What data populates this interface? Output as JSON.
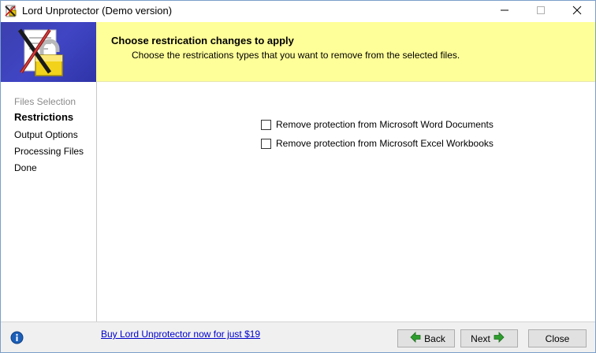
{
  "window": {
    "title": "Lord Unprotector (Demo version)",
    "icons": {
      "app": "lord-unprotector-app-icon",
      "minimize": "minimize-icon",
      "maximize": "maximize-icon",
      "close": "close-icon"
    }
  },
  "header": {
    "title": "Choose restrication changes to apply",
    "subtitle": "Choose the restrications types that you want to remove from the selected files.",
    "background_color": "#ffff99",
    "logo": "unlocked-padlock-document-logo"
  },
  "sidebar": {
    "steps": [
      {
        "label": "Files Selection",
        "state": "completed"
      },
      {
        "label": "Restrictions",
        "state": "active"
      },
      {
        "label": "Output Options",
        "state": "pending"
      },
      {
        "label": "Processing Files",
        "state": "pending"
      },
      {
        "label": "Done",
        "state": "pending"
      }
    ]
  },
  "options": [
    {
      "label": "Remove protection from Microsoft Word Documents",
      "checked": false
    },
    {
      "label": "Remove protection from Microsoft Excel Workbooks",
      "checked": false
    }
  ],
  "footer": {
    "info_icon": "info-icon",
    "buy_link": "Buy Lord Unprotector now for just $19",
    "link_color": "#0000cc",
    "back_label": "Back",
    "next_label": "Next",
    "close_label": "Close",
    "arrow_color": "#2e9e2e"
  }
}
